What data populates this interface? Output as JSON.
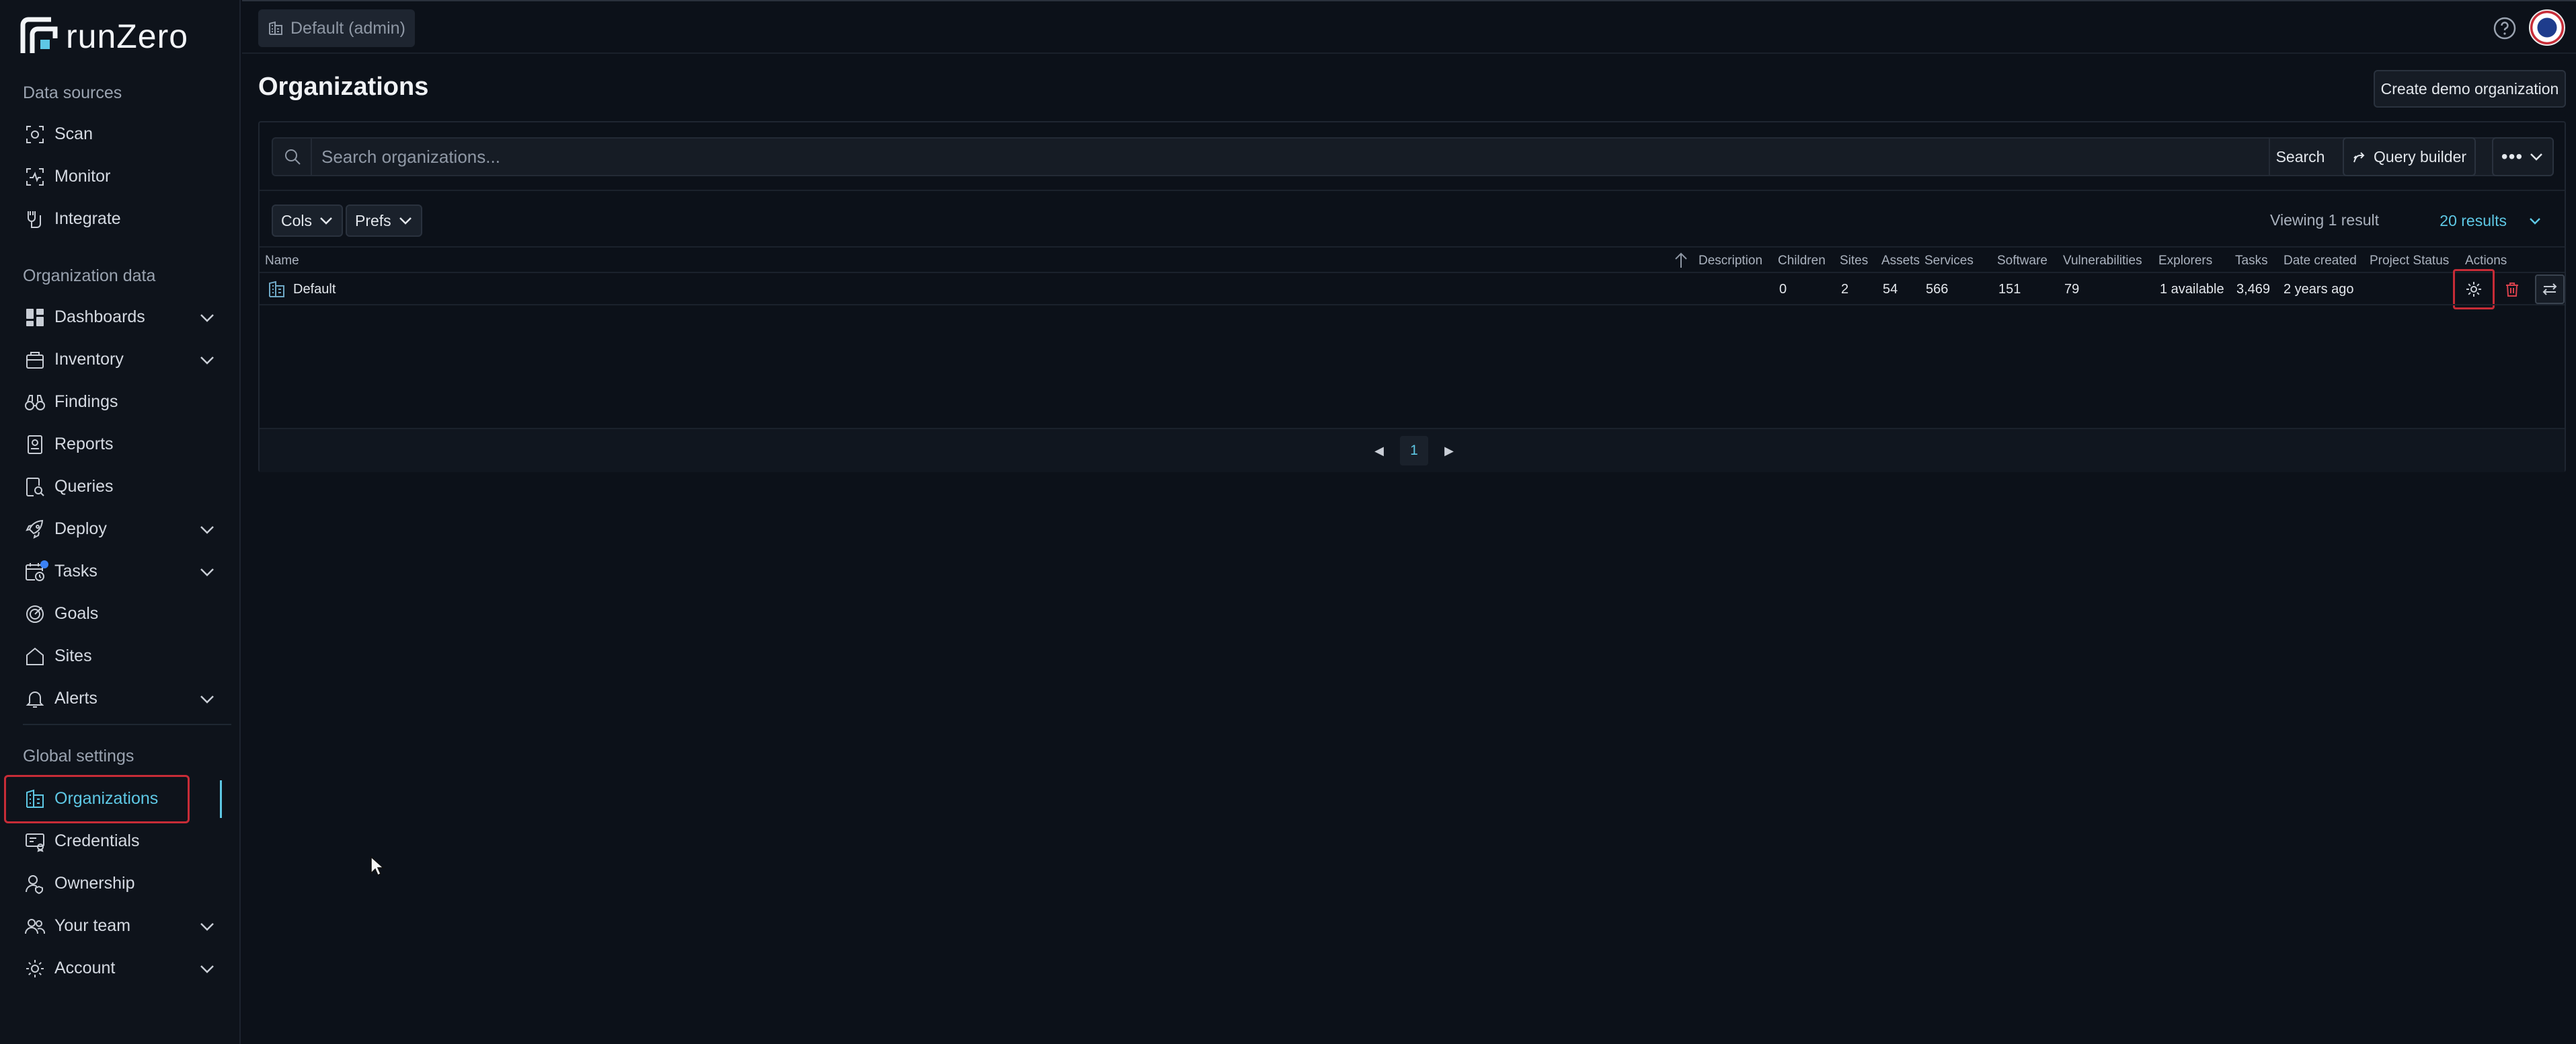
{
  "app": {
    "logo_text": "runZero"
  },
  "topbar": {
    "org_chip": "Default (admin)"
  },
  "sidebar": {
    "sections": [
      {
        "label": "Data sources"
      },
      {
        "label": "Organization data"
      },
      {
        "label": "Global settings"
      }
    ],
    "items": [
      {
        "label": "Scan"
      },
      {
        "label": "Monitor"
      },
      {
        "label": "Integrate"
      },
      {
        "label": "Dashboards"
      },
      {
        "label": "Inventory"
      },
      {
        "label": "Findings"
      },
      {
        "label": "Reports"
      },
      {
        "label": "Queries"
      },
      {
        "label": "Deploy"
      },
      {
        "label": "Tasks"
      },
      {
        "label": "Goals"
      },
      {
        "label": "Sites"
      },
      {
        "label": "Alerts"
      },
      {
        "label": "Organizations"
      },
      {
        "label": "Credentials"
      },
      {
        "label": "Ownership"
      },
      {
        "label": "Your team"
      },
      {
        "label": "Account"
      }
    ]
  },
  "main": {
    "title": "Organizations",
    "create_demo_label": "Create demo organization",
    "search": {
      "placeholder": "Search organizations...",
      "button": "Search"
    },
    "query_builder_label": "Query builder",
    "cols_label": "Cols",
    "prefs_label": "Prefs",
    "viewing_text": "Viewing 1 result",
    "results_text": "20 results",
    "columns": [
      "Name",
      "Description",
      "Children",
      "Sites",
      "Assets",
      "Services",
      "Software",
      "Vulnerabilities",
      "Explorers",
      "Tasks",
      "Date created",
      "Project Status",
      "Actions"
    ],
    "rows": [
      {
        "name": "Default",
        "description": "",
        "children": "0",
        "sites": "2",
        "assets": "54",
        "services": "566",
        "software": "151",
        "vulnerabilities": "79",
        "explorers": "1 available",
        "tasks": "3,469",
        "date_created": "2 years ago",
        "project_status": ""
      }
    ],
    "pager": {
      "current": "1"
    }
  },
  "colors": {
    "accent": "#5ec8e5",
    "highlight": "#c72c37",
    "background": "#0c1119"
  }
}
